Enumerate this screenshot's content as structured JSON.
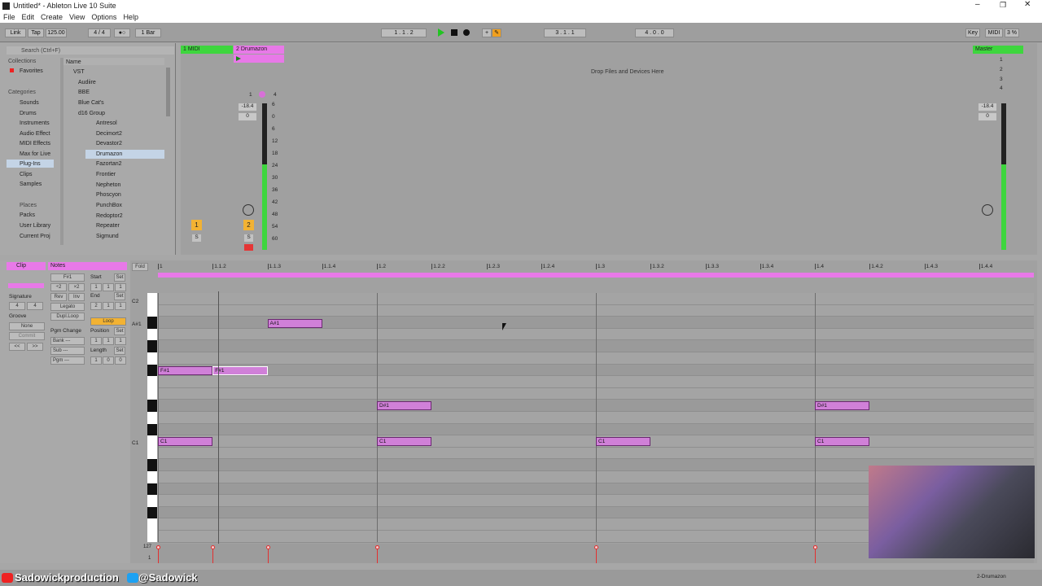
{
  "window": {
    "title": "Untitled* - Ableton Live 10 Suite"
  },
  "menu": [
    "File",
    "Edit",
    "Create",
    "View",
    "Options",
    "Help"
  ],
  "transport": {
    "link": "Link",
    "tap": "Tap",
    "tempo": "125.00",
    "signature": "4 / 4",
    "quantize": "1 Bar",
    "position": "1 .   1 .   2",
    "loop_start": "3 .   1 .   1",
    "loop_length": "4 .   0 .   0",
    "key": "Key",
    "midi": "MIDI",
    "cpu": "3 %"
  },
  "browser": {
    "search_placeholder": "Search (Ctrl+F)",
    "collections_header": "Collections",
    "favorites": "Favorites",
    "categories_header": "Categories",
    "categories": [
      "Sounds",
      "Drums",
      "Instruments",
      "Audio Effect",
      "MIDI Effects",
      "Max for Live",
      "Plug-Ins",
      "Clips",
      "Samples"
    ],
    "places_header": "Places",
    "places": [
      "Packs",
      "User Library",
      "Current Proj"
    ],
    "name_header": "Name",
    "tree": [
      "VST",
      "Audiire",
      "BBE",
      "Blue Cat's",
      "d16 Group"
    ],
    "plugins": [
      "Antresol",
      "Decimort2",
      "Devastor2",
      "Drumazon",
      "Fazortan2",
      "Frontier",
      "Nepheton",
      "Phoscyon",
      "PunchBox",
      "Redoptor2",
      "Repeater",
      "Sigmund"
    ],
    "selected_plugin": "Drumazon"
  },
  "session": {
    "tracks": [
      "1 MIDI",
      "2 Drumazon"
    ],
    "master": "Master",
    "drop_hint": "Drop Files and Devices Here",
    "track2_volume": "-18.4",
    "track2_pan": "0",
    "master_volume": "-18.4",
    "master_pan": "0",
    "meter_scale": [
      "6",
      "0",
      "6",
      "12",
      "18",
      "24",
      "30",
      "36",
      "42",
      "48",
      "54",
      "60"
    ],
    "track_numbers": [
      "1",
      "2"
    ],
    "scene_numbers": [
      "1",
      "2",
      "3",
      "4"
    ],
    "solo": "S",
    "sends": [
      "1",
      "4"
    ]
  },
  "clip_panel": {
    "clip_tab": "Clip",
    "notes_tab": "Notes",
    "signature_label": "Signature",
    "signature_num": "4",
    "signature_den": "4",
    "groove_label": "Groove",
    "groove_value": "None",
    "commit": "Commit",
    "key": "F#1",
    "transpose_down": "÷2",
    "transpose_up": "×2",
    "rev": "Rev",
    "inv": "Inv",
    "legato": "Legato",
    "dupl_loop": "Dupl.Loop",
    "pgm_change": "Pgm Change",
    "bank": "Bank ---",
    "sub": "Sub ---",
    "pgm": "Pgm ---",
    "start": "Start",
    "end": "End",
    "set": "Set",
    "start_value": [
      "1",
      "1",
      "1"
    ],
    "end_value": [
      "2",
      "1",
      "1"
    ],
    "loop": "Loop",
    "position": "Position",
    "position_value": [
      "1",
      "1",
      "1"
    ],
    "length": "Length",
    "length_value": [
      "1",
      "0",
      "0"
    ],
    "nav_left": "<<",
    "nav_right": ">>"
  },
  "piano_roll": {
    "fold": "Fold",
    "ruler": [
      "1",
      "1.1.2",
      "1.1.3",
      "1.1.4",
      "1.2",
      "1.2.2",
      "1.2.3",
      "1.2.4",
      "1.3",
      "1.3.2",
      "1.3.3",
      "1.3.4",
      "1.4",
      "1.4.2",
      "1.4.3",
      "1.4.4"
    ],
    "key_labels": {
      "c2": "C2",
      "a1": "A#1",
      "c1": "C1"
    },
    "velocity_max": "127",
    "velocity_min": "1",
    "notes": [
      {
        "pitch": "A#1",
        "start": 0.5,
        "length": 0.25,
        "label": "A#1",
        "row": "a1"
      },
      {
        "pitch": "F#1",
        "start": 0.0,
        "length": 0.25,
        "label": "F#1",
        "row": "f1"
      },
      {
        "pitch": "F#1",
        "start": 0.25,
        "length": 0.25,
        "label": "F#1",
        "row": "f1",
        "selected": true
      },
      {
        "pitch": "D#1",
        "start": 1.0,
        "length": 0.25,
        "label": "D#1",
        "row": "d1"
      },
      {
        "pitch": "D#1",
        "start": 3.0,
        "length": 0.25,
        "label": "D#1",
        "row": "d1"
      },
      {
        "pitch": "C1",
        "start": 0.0,
        "length": 0.25,
        "label": "C1",
        "row": "c1"
      },
      {
        "pitch": "C1",
        "start": 1.0,
        "length": 0.25,
        "label": "C1",
        "row": "c1"
      },
      {
        "pitch": "C1",
        "start": 2.0,
        "length": 0.25,
        "label": "C1",
        "row": "c1"
      },
      {
        "pitch": "C1",
        "start": 3.0,
        "length": 0.25,
        "label": "C1",
        "row": "c1"
      }
    ]
  },
  "overlay": {
    "youtube": "Sadowickproduction",
    "twitter": "@Sadowick"
  },
  "status": {
    "device": "2-Drumazon"
  }
}
